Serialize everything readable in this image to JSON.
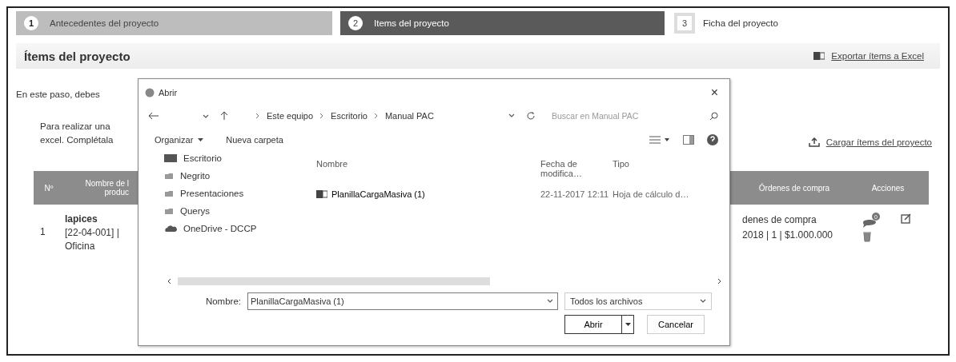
{
  "steps": [
    {
      "number": "1",
      "label": "Antecedentes del proyecto",
      "completed": true,
      "selected": false
    },
    {
      "number": "2",
      "label": "Items del proyecto",
      "completed": false,
      "selected": true
    },
    {
      "number": "3",
      "label": "Ficha del proyecto",
      "completed": false,
      "selected": false
    }
  ],
  "section": {
    "title": "Ítems del proyecto",
    "export_link": "Exportar ítems a Excel"
  },
  "intro": "En este paso, debes",
  "instructions": [
    "Para realizar una",
    "excel. Complétala"
  ],
  "upload_link": "Cargar ítems del proyecto",
  "table": {
    "columns": [
      {
        "lines": [
          "Nº"
        ]
      },
      {
        "lines": [
          "Nombre de l",
          "produc"
        ]
      },
      {
        "lines": [
          "Órdenes de compra"
        ]
      },
      {
        "lines": [
          "Acciones"
        ]
      }
    ],
    "rows": [
      {
        "number": "1",
        "name": "lapices",
        "code": "[22-04-001] |",
        "category": "Oficina",
        "orders": [
          "denes de compra",
          "2018 | 1 | $1.000.000"
        ],
        "comment_count": "0"
      }
    ]
  },
  "dialog": {
    "title": "Abrir",
    "close": "×",
    "breadcrumb": [
      "Este equipo",
      "Escritorio",
      "Manual PAC"
    ],
    "search_placeholder": "Buscar en Manual PAC",
    "toolbar": [
      "Organizar",
      "Nueva carpeta"
    ],
    "nav": [
      {
        "label": "Escritorio",
        "kind": "desktop"
      },
      {
        "label": "Negrito",
        "kind": "folder"
      },
      {
        "label": "Presentaciones",
        "kind": "folder"
      },
      {
        "label": "Querys",
        "kind": "folder"
      },
      {
        "label": "OneDrive - DCCP",
        "kind": "cloud"
      }
    ],
    "columns": [
      "Nombre",
      "Fecha de modifica…",
      "Tipo"
    ],
    "files": [
      {
        "name": "PlanillaCargaMasiva (1)",
        "date": "22-11-2017 12:11",
        "type": "Hoja de cálculo d…",
        "selected": false
      }
    ],
    "filename_label": "Nombre:",
    "filename": "PlanillaCargaMasiva (1)",
    "filetype": "Todos los archivos",
    "open": "Abrir",
    "cancel": "Cancelar"
  }
}
